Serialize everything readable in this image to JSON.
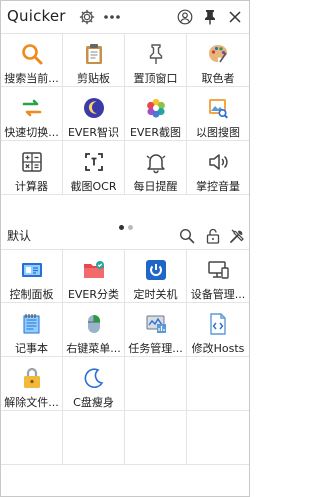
{
  "app": {
    "title": "Quicker"
  },
  "section": {
    "label": "默认"
  },
  "grid1": [
    {
      "label": "搜索当前..."
    },
    {
      "label": "剪贴板"
    },
    {
      "label": "置顶窗口"
    },
    {
      "label": "取色者"
    },
    {
      "label": "快速切换..."
    },
    {
      "label": "EVER智识"
    },
    {
      "label": "EVER截图"
    },
    {
      "label": "以图搜图"
    },
    {
      "label": "计算器"
    },
    {
      "label": "截图OCR"
    },
    {
      "label": "每日提醒"
    },
    {
      "label": "掌控音量"
    }
  ],
  "grid2": [
    {
      "label": "控制面板"
    },
    {
      "label": "EVER分类"
    },
    {
      "label": "定时关机"
    },
    {
      "label": "设备管理..."
    },
    {
      "label": "记事本"
    },
    {
      "label": "右键菜单..."
    },
    {
      "label": "任务管理..."
    },
    {
      "label": "修改Hosts"
    },
    {
      "label": "解除文件..."
    },
    {
      "label": "C盘瘦身"
    }
  ],
  "pager": {
    "page_count": 2,
    "current_page": 1
  }
}
